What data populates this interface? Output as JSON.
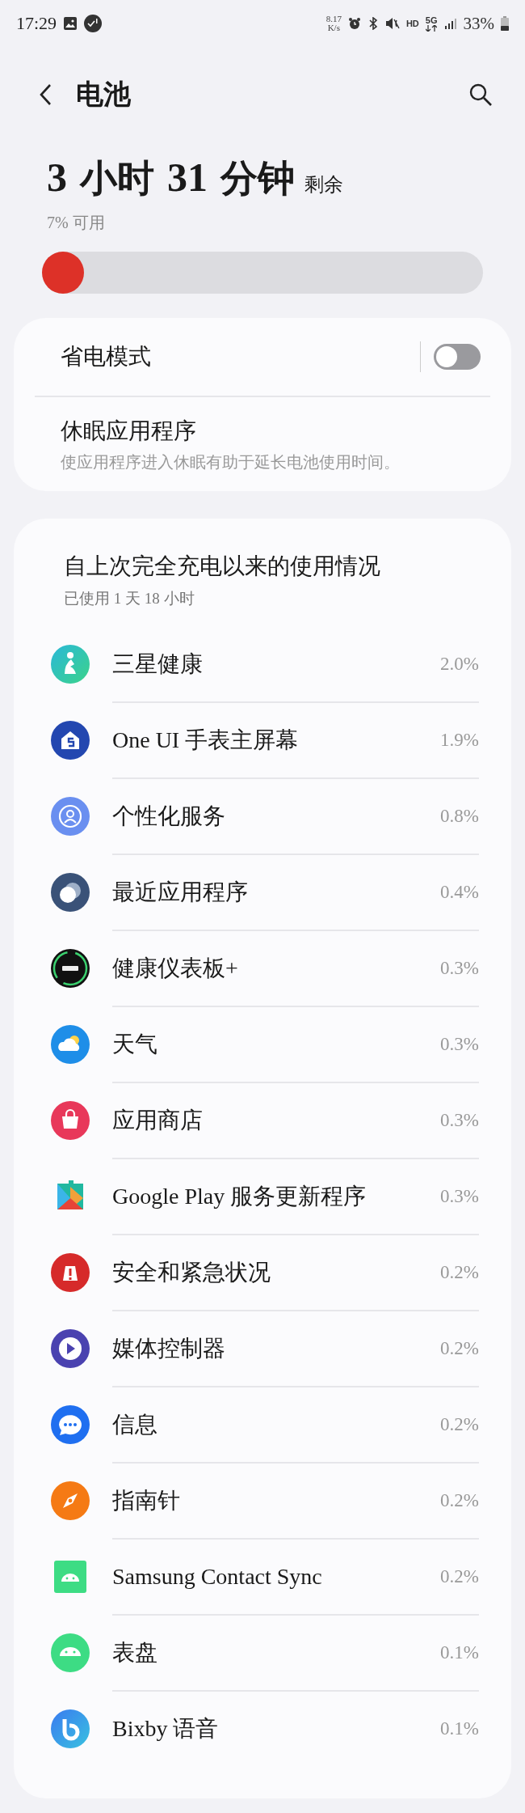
{
  "status_bar": {
    "time": "17:29",
    "net_speed": [
      "8.17",
      "K/s"
    ],
    "hd": "HD",
    "network": "5G",
    "battery": "33%"
  },
  "header": {
    "title": "电池"
  },
  "summary": {
    "time_left": [
      {
        "text": "3",
        "kind": "num"
      },
      {
        "text": "小时",
        "kind": "unit"
      },
      {
        "text": "31",
        "kind": "num"
      },
      {
        "text": "分钟",
        "kind": "unit"
      }
    ],
    "suffix": "剩余",
    "available": "7% 可用",
    "level": 0.07
  },
  "settings": [
    {
      "kind": "toggle",
      "title": "省电模式",
      "on": false
    },
    {
      "kind": "link",
      "title": "休眠应用程序",
      "subtitle": "使应用程序进入休眠有助于延长电池使用时间。"
    }
  ],
  "usage": {
    "title": "自上次完全充电以来的使用情况",
    "subtitle": "已使用 1 天 18 小时",
    "apps": [
      {
        "name": "三星健康",
        "percent": "2.0%"
      },
      {
        "name": "One UI 手表主屏幕",
        "percent": "1.9%"
      },
      {
        "name": "个性化服务",
        "percent": "0.8%"
      },
      {
        "name": "最近应用程序",
        "percent": "0.4%"
      },
      {
        "name": "健康仪表板+",
        "percent": "0.3%"
      },
      {
        "name": "天气",
        "percent": "0.3%"
      },
      {
        "name": "应用商店",
        "percent": "0.3%"
      },
      {
        "name": "Google Play 服务更新程序",
        "percent": "0.3%"
      },
      {
        "name": "安全和紧急状况",
        "percent": "0.2%"
      },
      {
        "name": "媒体控制器",
        "percent": "0.2%"
      },
      {
        "name": "信息",
        "percent": "0.2%"
      },
      {
        "name": "指南针",
        "percent": "0.2%"
      },
      {
        "name": "Samsung Contact Sync",
        "percent": "0.2%"
      },
      {
        "name": "表盘",
        "percent": "0.1%"
      },
      {
        "name": "Bixby 语音",
        "percent": "0.1%"
      }
    ]
  }
}
